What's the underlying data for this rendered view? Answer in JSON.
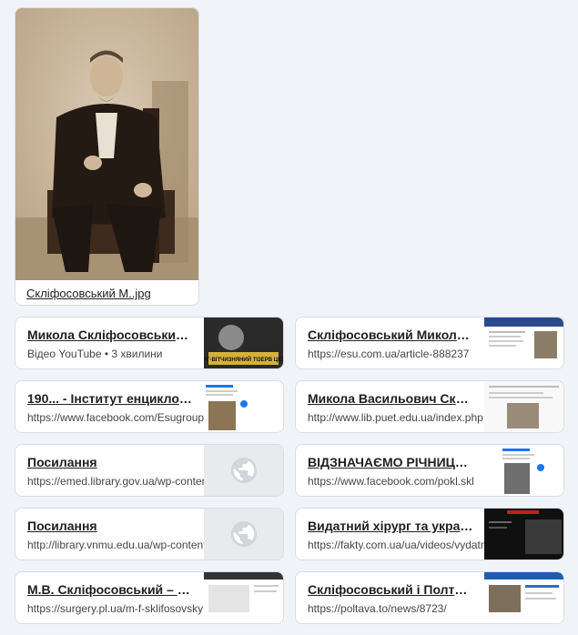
{
  "image_card": {
    "caption": "Скліфосовський М..jpg"
  },
  "results": [
    {
      "title": "Микола Скліфосовський - ...",
      "subtitle": "Відео YouTube • 3 хвилини",
      "thumb_text": "ХИРОРГ-ВІТЧИЗНЯНИЙ ТІЗЕРВ ЦЕТИ ОН",
      "thumb": "video"
    },
    {
      "title": "Скліфосовський Микола В...",
      "subtitle": "https://esu.com.ua/article-888237",
      "thumb": "esu"
    },
    {
      "title": "190... - Інститут енциклоп...",
      "subtitle": "https://www.facebook.com/Esugroup",
      "thumb": "facebook"
    },
    {
      "title": "Микола Васильович Скліф...",
      "subtitle": "http://www.lib.puet.edu.ua/index.php",
      "thumb": "lib"
    },
    {
      "title": "Посилання",
      "subtitle": "https://emed.library.gov.ua/wp-content",
      "thumb": "globe"
    },
    {
      "title": "ВІДЗНАЧАЄМО РІЧНИЦЮ ...",
      "subtitle": "https://www.facebook.com/pokl.skl",
      "thumb": "facebook"
    },
    {
      "title": "Посилання",
      "subtitle": "http://library.vnmu.edu.ua/wp-content",
      "thumb": "globe"
    },
    {
      "title": "Видатний хірург та украї...",
      "subtitle": "https://fakty.com.ua/ua/videos/vydatn",
      "thumb": "fakty"
    },
    {
      "title": "М.В. Скліфосовський – Ас...",
      "subtitle": "https://surgery.pl.ua/m-f-sklifosovsky",
      "thumb": "surgery"
    },
    {
      "title": "Скліфосовський і Полтава...",
      "subtitle": "https://poltava.to/news/8723/",
      "thumb": "poltava"
    }
  ]
}
